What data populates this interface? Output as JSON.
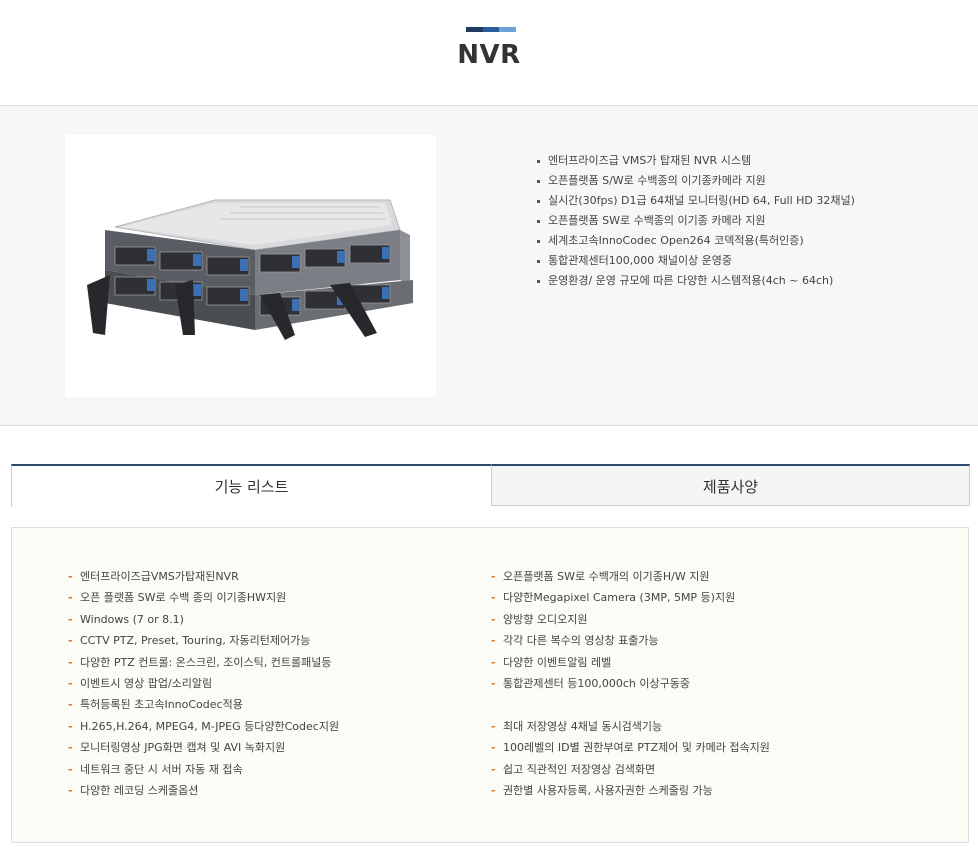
{
  "header": {
    "title": "NVR",
    "accent_colors": [
      "#1f3a5f",
      "#2a5d9c",
      "#6aa3d8"
    ]
  },
  "product": {
    "image_alt": "rack-mount NVR server",
    "features": [
      "엔터프라이즈급 VMS가 탑재된 NVR 시스템",
      "오픈플랫폼 S/W로 수백종의 이기종카메라 지원",
      "실시간(30fps) D1급 64채널 모니터링(HD 64, Full HD 32채널)",
      "오픈플랫폼 SW로 수백종의 이기종 카메라 지원",
      "세계초고속InnoCodec Open264 코덱적용(특허인증)",
      "통합관제센터100,000 채널이상 운영중",
      "운영환경/ 운영 규모에 따른 다양한 시스템적용(4ch ~ 64ch)"
    ]
  },
  "tabs": [
    {
      "label": "기능 리스트",
      "active": true
    },
    {
      "label": "제품사양",
      "active": false
    }
  ],
  "function_list": {
    "left": [
      "엔터프라이즈급VMS가탑재된NVR",
      "오픈 플랫폼 SW로 수백 종의 이기종HW지원",
      "Windows (7 or 8.1)",
      "CCTV PTZ, Preset, Touring, 자동리턴제어가능",
      "다양한 PTZ 컨트롤: 온스크린, 조이스틱, 컨트롤패널등",
      "이벤트시 영상 팝업/소리알림",
      "특허등록된 초고속InnoCodec적용",
      "H.265,H.264, MPEG4, M-JPEG 등다양한Codec지원",
      "모니터링영상 JPG화면 캡쳐 및 AVI 녹화지원",
      "네트워크 중단 시 서버 자동 재 접속",
      "다양한 레코딩 스케줄옵션"
    ],
    "right": [
      "오픈플랫폼 SW로 수백개의 이기종H/W 지원",
      "다양한Megapixel Camera (3MP, 5MP 등)지원",
      "양방향 오디오지원",
      "각각 다른 복수의 영상창 표출가능",
      "다양한 이벤트알림 레벨",
      "통합관제센터 등100,000ch 이상구동중",
      "",
      "최대 저장영상 4채널 동시검색기능",
      "100레벨의 ID별 권한부여로 PTZ제어 및 카메라 접속지원",
      "쉽고 직관적인 저장영상 검색화면",
      "권한별 사용자등록, 사용자권한 스케줄링 가능"
    ]
  }
}
